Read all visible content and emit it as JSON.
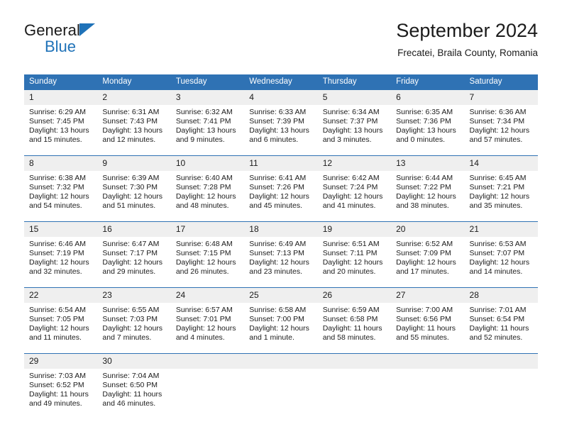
{
  "brand": {
    "name_top": "General",
    "name_bottom": "Blue",
    "triangle_color": "#1f72b8"
  },
  "header": {
    "title": "September 2024",
    "subtitle": "Frecatei, Braila County, Romania"
  },
  "theme": {
    "header_blue": "#2f72b4",
    "daynum_gray": "#efefef",
    "text": "#1b1b1b"
  },
  "weekday_headers": [
    "Sunday",
    "Monday",
    "Tuesday",
    "Wednesday",
    "Thursday",
    "Friday",
    "Saturday"
  ],
  "labels": {
    "sunrise_prefix": "Sunrise:",
    "sunset_prefix": "Sunset:",
    "daylight_prefix": "Daylight:"
  },
  "weeks": [
    [
      {
        "day": "1",
        "sunrise": "Sunrise: 6:29 AM",
        "sunset": "Sunset: 7:45 PM",
        "daylight1": "Daylight: 13 hours",
        "daylight2": "and 15 minutes."
      },
      {
        "day": "2",
        "sunrise": "Sunrise: 6:31 AM",
        "sunset": "Sunset: 7:43 PM",
        "daylight1": "Daylight: 13 hours",
        "daylight2": "and 12 minutes."
      },
      {
        "day": "3",
        "sunrise": "Sunrise: 6:32 AM",
        "sunset": "Sunset: 7:41 PM",
        "daylight1": "Daylight: 13 hours",
        "daylight2": "and 9 minutes."
      },
      {
        "day": "4",
        "sunrise": "Sunrise: 6:33 AM",
        "sunset": "Sunset: 7:39 PM",
        "daylight1": "Daylight: 13 hours",
        "daylight2": "and 6 minutes."
      },
      {
        "day": "5",
        "sunrise": "Sunrise: 6:34 AM",
        "sunset": "Sunset: 7:37 PM",
        "daylight1": "Daylight: 13 hours",
        "daylight2": "and 3 minutes."
      },
      {
        "day": "6",
        "sunrise": "Sunrise: 6:35 AM",
        "sunset": "Sunset: 7:36 PM",
        "daylight1": "Daylight: 13 hours",
        "daylight2": "and 0 minutes."
      },
      {
        "day": "7",
        "sunrise": "Sunrise: 6:36 AM",
        "sunset": "Sunset: 7:34 PM",
        "daylight1": "Daylight: 12 hours",
        "daylight2": "and 57 minutes."
      }
    ],
    [
      {
        "day": "8",
        "sunrise": "Sunrise: 6:38 AM",
        "sunset": "Sunset: 7:32 PM",
        "daylight1": "Daylight: 12 hours",
        "daylight2": "and 54 minutes."
      },
      {
        "day": "9",
        "sunrise": "Sunrise: 6:39 AM",
        "sunset": "Sunset: 7:30 PM",
        "daylight1": "Daylight: 12 hours",
        "daylight2": "and 51 minutes."
      },
      {
        "day": "10",
        "sunrise": "Sunrise: 6:40 AM",
        "sunset": "Sunset: 7:28 PM",
        "daylight1": "Daylight: 12 hours",
        "daylight2": "and 48 minutes."
      },
      {
        "day": "11",
        "sunrise": "Sunrise: 6:41 AM",
        "sunset": "Sunset: 7:26 PM",
        "daylight1": "Daylight: 12 hours",
        "daylight2": "and 45 minutes."
      },
      {
        "day": "12",
        "sunrise": "Sunrise: 6:42 AM",
        "sunset": "Sunset: 7:24 PM",
        "daylight1": "Daylight: 12 hours",
        "daylight2": "and 41 minutes."
      },
      {
        "day": "13",
        "sunrise": "Sunrise: 6:44 AM",
        "sunset": "Sunset: 7:22 PM",
        "daylight1": "Daylight: 12 hours",
        "daylight2": "and 38 minutes."
      },
      {
        "day": "14",
        "sunrise": "Sunrise: 6:45 AM",
        "sunset": "Sunset: 7:21 PM",
        "daylight1": "Daylight: 12 hours",
        "daylight2": "and 35 minutes."
      }
    ],
    [
      {
        "day": "15",
        "sunrise": "Sunrise: 6:46 AM",
        "sunset": "Sunset: 7:19 PM",
        "daylight1": "Daylight: 12 hours",
        "daylight2": "and 32 minutes."
      },
      {
        "day": "16",
        "sunrise": "Sunrise: 6:47 AM",
        "sunset": "Sunset: 7:17 PM",
        "daylight1": "Daylight: 12 hours",
        "daylight2": "and 29 minutes."
      },
      {
        "day": "17",
        "sunrise": "Sunrise: 6:48 AM",
        "sunset": "Sunset: 7:15 PM",
        "daylight1": "Daylight: 12 hours",
        "daylight2": "and 26 minutes."
      },
      {
        "day": "18",
        "sunrise": "Sunrise: 6:49 AM",
        "sunset": "Sunset: 7:13 PM",
        "daylight1": "Daylight: 12 hours",
        "daylight2": "and 23 minutes."
      },
      {
        "day": "19",
        "sunrise": "Sunrise: 6:51 AM",
        "sunset": "Sunset: 7:11 PM",
        "daylight1": "Daylight: 12 hours",
        "daylight2": "and 20 minutes."
      },
      {
        "day": "20",
        "sunrise": "Sunrise: 6:52 AM",
        "sunset": "Sunset: 7:09 PM",
        "daylight1": "Daylight: 12 hours",
        "daylight2": "and 17 minutes."
      },
      {
        "day": "21",
        "sunrise": "Sunrise: 6:53 AM",
        "sunset": "Sunset: 7:07 PM",
        "daylight1": "Daylight: 12 hours",
        "daylight2": "and 14 minutes."
      }
    ],
    [
      {
        "day": "22",
        "sunrise": "Sunrise: 6:54 AM",
        "sunset": "Sunset: 7:05 PM",
        "daylight1": "Daylight: 12 hours",
        "daylight2": "and 11 minutes."
      },
      {
        "day": "23",
        "sunrise": "Sunrise: 6:55 AM",
        "sunset": "Sunset: 7:03 PM",
        "daylight1": "Daylight: 12 hours",
        "daylight2": "and 7 minutes."
      },
      {
        "day": "24",
        "sunrise": "Sunrise: 6:57 AM",
        "sunset": "Sunset: 7:01 PM",
        "daylight1": "Daylight: 12 hours",
        "daylight2": "and 4 minutes."
      },
      {
        "day": "25",
        "sunrise": "Sunrise: 6:58 AM",
        "sunset": "Sunset: 7:00 PM",
        "daylight1": "Daylight: 12 hours",
        "daylight2": "and 1 minute."
      },
      {
        "day": "26",
        "sunrise": "Sunrise: 6:59 AM",
        "sunset": "Sunset: 6:58 PM",
        "daylight1": "Daylight: 11 hours",
        "daylight2": "and 58 minutes."
      },
      {
        "day": "27",
        "sunrise": "Sunrise: 7:00 AM",
        "sunset": "Sunset: 6:56 PM",
        "daylight1": "Daylight: 11 hours",
        "daylight2": "and 55 minutes."
      },
      {
        "day": "28",
        "sunrise": "Sunrise: 7:01 AM",
        "sunset": "Sunset: 6:54 PM",
        "daylight1": "Daylight: 11 hours",
        "daylight2": "and 52 minutes."
      }
    ],
    [
      {
        "day": "29",
        "sunrise": "Sunrise: 7:03 AM",
        "sunset": "Sunset: 6:52 PM",
        "daylight1": "Daylight: 11 hours",
        "daylight2": "and 49 minutes."
      },
      {
        "day": "30",
        "sunrise": "Sunrise: 7:04 AM",
        "sunset": "Sunset: 6:50 PM",
        "daylight1": "Daylight: 11 hours",
        "daylight2": "and 46 minutes."
      },
      {
        "day": "",
        "sunrise": "",
        "sunset": "",
        "daylight1": "",
        "daylight2": ""
      },
      {
        "day": "",
        "sunrise": "",
        "sunset": "",
        "daylight1": "",
        "daylight2": ""
      },
      {
        "day": "",
        "sunrise": "",
        "sunset": "",
        "daylight1": "",
        "daylight2": ""
      },
      {
        "day": "",
        "sunrise": "",
        "sunset": "",
        "daylight1": "",
        "daylight2": ""
      },
      {
        "day": "",
        "sunrise": "",
        "sunset": "",
        "daylight1": "",
        "daylight2": ""
      }
    ]
  ]
}
